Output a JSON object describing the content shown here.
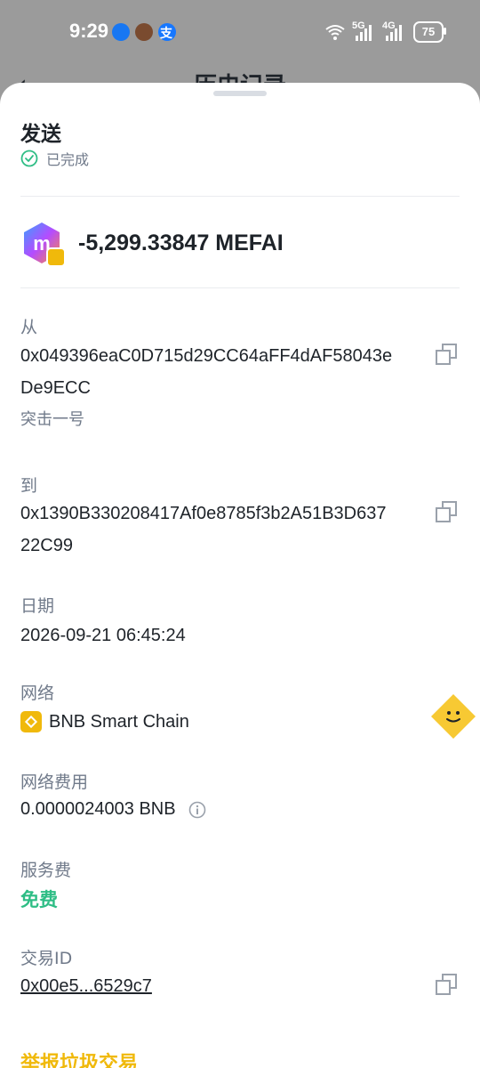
{
  "status_bar": {
    "time": "9:29",
    "network1": "5G",
    "network2": "4G",
    "battery": "75"
  },
  "header": {
    "title": "历史记录",
    "back_icon": "back-arrow-icon"
  },
  "transaction": {
    "title": "发送",
    "status": "已完成",
    "amount": "-5,299.33847 MEFAI",
    "from_label": "从",
    "from_address": "0x049396eaC0D715d29CC64aFF4dAF58043eDe9ECC",
    "from_name": "突击一号",
    "to_label": "到",
    "to_address": "0x1390B330208417Af0e8785f3b2A51B3D63722C99",
    "date_label": "日期",
    "date_value": "2026-09-21 06:45:24",
    "network_label": "网络",
    "network_value": "BNB Smart Chain",
    "fee_label": "网络费用",
    "fee_value": "0.0000024003 BNB",
    "service_fee_label": "服务费",
    "service_fee_value": "免费",
    "tx_id_label": "交易ID",
    "tx_id_value": "0x00e5...6529c7",
    "report_label": "举报垃圾交易"
  },
  "colors": {
    "accent_green": "#2ebd85",
    "accent_yellow": "#f0b90b",
    "text_primary": "#1e2329",
    "text_secondary": "#707a8a"
  }
}
